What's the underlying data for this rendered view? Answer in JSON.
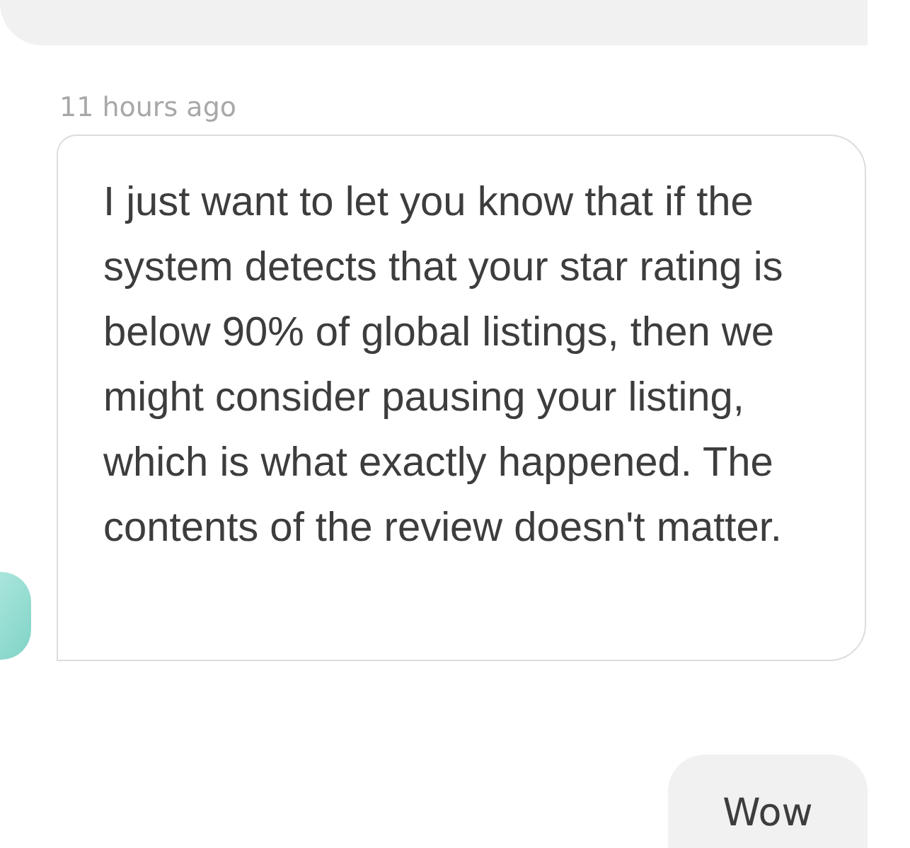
{
  "timestamp": "11 hours ago",
  "message": {
    "text": "I just want to let you know that if the system detects that your star rating is below 90% of global listings, then we might consider pausing your listing, which is what exactly happened. The contents of the review doesn't matter."
  },
  "reply": {
    "text": "Wow"
  }
}
